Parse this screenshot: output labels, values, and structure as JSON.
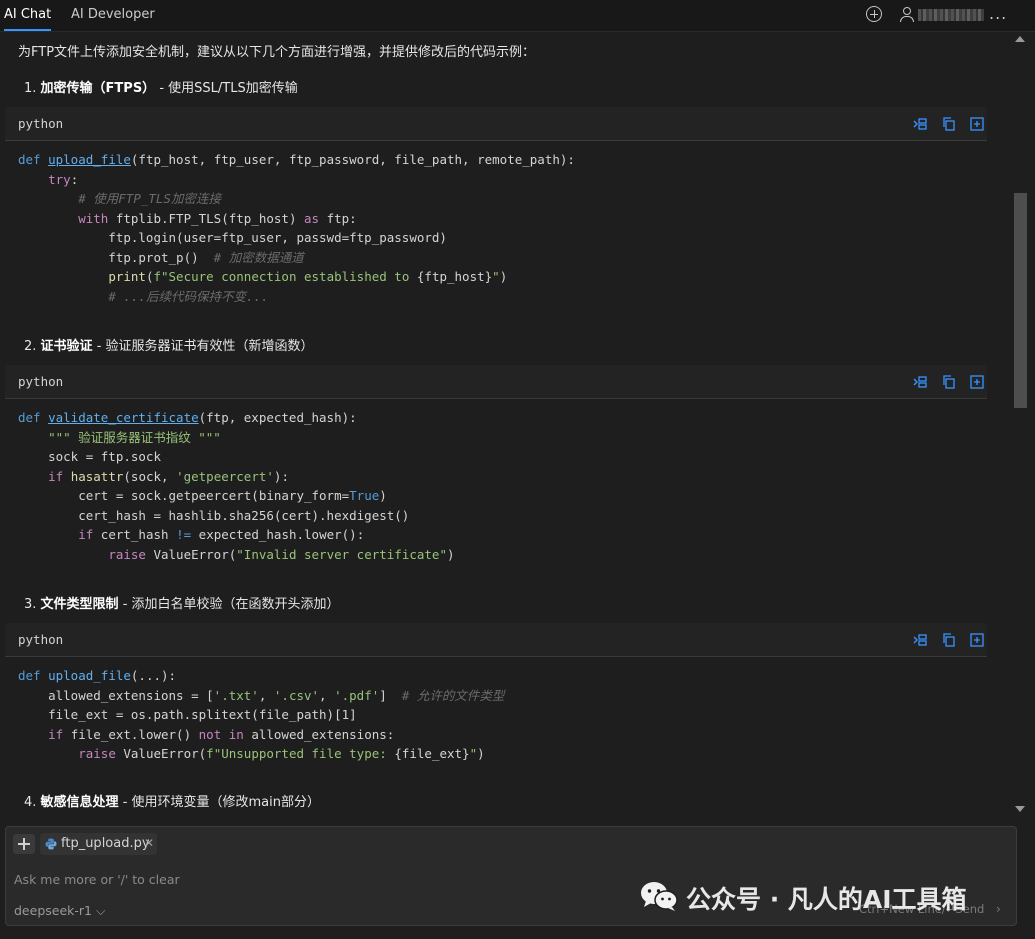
{
  "tabs": [
    {
      "label": "AI Chat",
      "active": true
    },
    {
      "label": "AI Developer",
      "active": false
    }
  ],
  "header": {
    "more_label": "...",
    "icons": [
      "plus-circle-icon",
      "account-icon"
    ]
  },
  "intro": "为FTP文件上传添加安全机制，建议从以下几个方面进行增强，并提供修改后的代码示例：",
  "sections": [
    {
      "number": "1.",
      "title": "加密传输（FTPS）",
      "desc": " - 使用SSL/TLS加密传输"
    },
    {
      "number": "2.",
      "title": "证书验证",
      "desc": " - 验证服务器证书有效性（新增函数）"
    },
    {
      "number": "3.",
      "title": "文件类型限制",
      "desc": " - 添加白名单校验（在函数开头添加）"
    },
    {
      "number": "4.",
      "title": "敏感信息处理",
      "desc": " - 使用环境变量（修改main部分）"
    }
  ],
  "code_blocks": [
    {
      "lang": "python",
      "lines": [
        "def upload_file(ftp_host, ftp_user, ftp_password, file_path, remote_path):",
        "    try:",
        "        # 使用FTP_TLS加密连接",
        "        with ftplib.FTP_TLS(ftp_host) as ftp:",
        "            ftp.login(user=ftp_user, passwd=ftp_password)",
        "            ftp.prot_p()  # 加密数据通道",
        "            print(f\"Secure connection established to {ftp_host}\")",
        "            # ...后续代码保持不变..."
      ]
    },
    {
      "lang": "python",
      "lines": [
        "def validate_certificate(ftp, expected_hash):",
        "    \"\"\" 验证服务器证书指纹 \"\"\"",
        "    sock = ftp.sock",
        "    if hasattr(sock, 'getpeercert'):",
        "        cert = sock.getpeercert(binary_form=True)",
        "        cert_hash = hashlib.sha256(cert).hexdigest()",
        "        if cert_hash != expected_hash.lower():",
        "            raise ValueError(\"Invalid server certificate\")"
      ]
    },
    {
      "lang": "python",
      "lines": [
        "def upload_file(...):",
        "    allowed_extensions = ['.txt', '.csv', '.pdf']  # 允许的文件类型",
        "    file_ext = os.path.splitext(file_path)[1]",
        "    if file_ext.lower() not in allowed_extensions:",
        "        raise ValueError(f\"Unsupported file type: {file_ext}\")"
      ]
    }
  ],
  "input": {
    "attached_file": "ftp_upload.py",
    "placeholder": "Ask me more or '/' to clear",
    "model": "deepseek-r1",
    "send_hint": "Ctrl+New Line/↵Send"
  },
  "watermark": {
    "text": "公众号 · 凡人的AI工具箱"
  }
}
